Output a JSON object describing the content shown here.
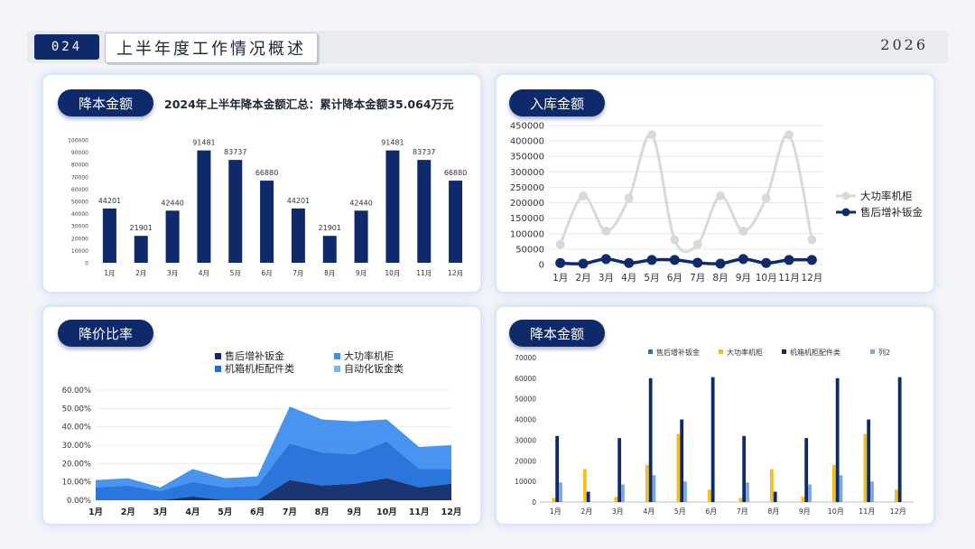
{
  "header": {
    "number": "024",
    "title": "上半年度工作情况概述",
    "year": "2026"
  },
  "panel1": {
    "pill": "降本金额",
    "summary": "2024年上半年降本金额汇总：累计降本金额35.064万元",
    "chart_data": {
      "type": "bar",
      "categories": [
        "1月",
        "2月",
        "3月",
        "4月",
        "5月",
        "6月",
        "7月",
        "8月",
        "9月",
        "10月",
        "11月",
        "12月"
      ],
      "values": [
        44201,
        21901,
        42440,
        91481,
        83737,
        66880,
        44201,
        21901,
        42440,
        91481,
        83737,
        66880
      ],
      "ylim": [
        0,
        100000
      ],
      "yticks": [
        0,
        10000,
        20000,
        30000,
        40000,
        50000,
        60000,
        70000,
        80000,
        90000,
        100000
      ],
      "color": "#0f2a6b"
    }
  },
  "panel2": {
    "pill": "入库金额",
    "chart_data": {
      "type": "line",
      "categories": [
        "1月",
        "2月",
        "3月",
        "4月",
        "5月",
        "6月",
        "7月",
        "8月",
        "9月",
        "10月",
        "11月",
        "12月"
      ],
      "ylim": [
        0,
        450000
      ],
      "yticks": [
        0,
        50000,
        100000,
        150000,
        200000,
        250000,
        300000,
        350000,
        400000,
        450000
      ],
      "series": [
        {
          "name": "大功率机柜",
          "color": "#d9d9d9",
          "values": [
            65000,
            222000,
            108000,
            215000,
            420000,
            80000,
            65000,
            222000,
            108000,
            215000,
            420000,
            80000
          ]
        },
        {
          "name": "售后增补钣金",
          "color": "#0f2a6b",
          "values": [
            5000,
            3000,
            18000,
            5000,
            15000,
            15000,
            6000,
            3000,
            18000,
            5000,
            15000,
            15000
          ]
        }
      ],
      "legend": "right"
    }
  },
  "panel3": {
    "pill": "降价比率",
    "chart_data": {
      "type": "area",
      "stacked": true,
      "categories": [
        "1月",
        "2月",
        "3月",
        "4月",
        "5月",
        "6月",
        "7月",
        "8月",
        "9月",
        "10月",
        "11月",
        "12月"
      ],
      "ylim": [
        0,
        0.6
      ],
      "ytick_labels": [
        "0.00%",
        "10.00%",
        "20.00%",
        "30.00%",
        "40.00%",
        "50.00%",
        "60.00%"
      ],
      "series": [
        {
          "name": "售后增补钣金",
          "color": "#0f2a6b",
          "values": [
            0.0,
            0.0,
            0.0,
            0.02,
            0.0,
            0.0,
            0.11,
            0.08,
            0.09,
            0.12,
            0.07,
            0.09
          ]
        },
        {
          "name": "机箱机柜配件类",
          "color": "#1f6fd8",
          "values": [
            0.07,
            0.08,
            0.05,
            0.08,
            0.07,
            0.08,
            0.2,
            0.18,
            0.16,
            0.2,
            0.1,
            0.08
          ]
        },
        {
          "name": "大功率机柜",
          "color": "#3d8ef0",
          "values": [
            0.04,
            0.04,
            0.02,
            0.07,
            0.05,
            0.05,
            0.2,
            0.18,
            0.18,
            0.12,
            0.12,
            0.13
          ]
        },
        {
          "name": "自动化钣金类",
          "color": "#7ab4f5",
          "values": [
            0.0,
            0.0,
            0.0,
            0.0,
            0.0,
            0.0,
            0.0,
            0.0,
            0.0,
            0.0,
            0.0,
            0.0
          ]
        }
      ],
      "legend": "top"
    }
  },
  "panel4": {
    "pill": "降本金额",
    "chart_data": {
      "type": "bar",
      "grouped": true,
      "categories": [
        "1月",
        "2月",
        "3月",
        "4月",
        "5月",
        "6月",
        "7月",
        "8月",
        "9月",
        "10月",
        "11月",
        "12月"
      ],
      "ylim": [
        0,
        70000
      ],
      "yticks": [
        0,
        10000,
        20000,
        30000,
        40000,
        50000,
        60000,
        70000
      ],
      "series": [
        {
          "name": "售后增补钣金",
          "color": "#2f6fb8",
          "values": [
            0,
            0,
            0,
            0,
            0,
            0,
            0,
            0,
            0,
            0,
            0,
            0
          ]
        },
        {
          "name": "大功率机柜",
          "color": "#f0c020",
          "values": [
            2000,
            16000,
            2500,
            18000,
            33000,
            6000,
            2000,
            16000,
            2500,
            18000,
            33000,
            6000
          ]
        },
        {
          "name": "机箱机柜配件类",
          "color": "#0f2a6b",
          "values": [
            32000,
            5000,
            31000,
            60000,
            40000,
            60500,
            32000,
            5000,
            31000,
            60000,
            40000,
            60500
          ]
        },
        {
          "name": "列2",
          "color": "#7ea6d8",
          "values": [
            9500,
            0,
            8500,
            13000,
            10000,
            0,
            9500,
            0,
            8500,
            13000,
            10000,
            0
          ]
        }
      ],
      "legend": "top"
    }
  }
}
